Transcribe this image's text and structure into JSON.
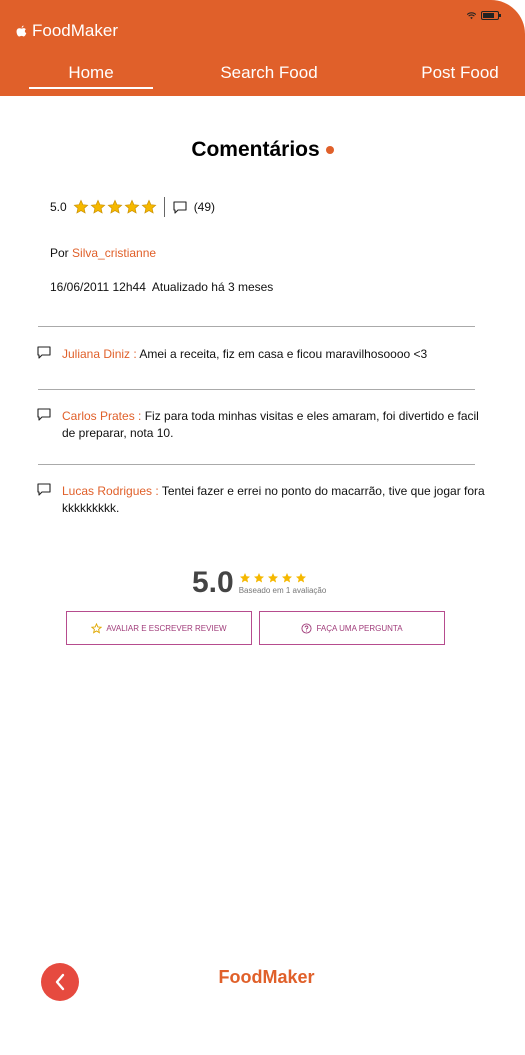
{
  "header": {
    "brand": "FoodMaker",
    "tabs": [
      {
        "label": "Home",
        "active": true
      },
      {
        "label": "Search Food",
        "active": false
      },
      {
        "label": "Post Food",
        "active": false
      }
    ]
  },
  "page": {
    "title": "Comentários",
    "rating_value": "5.0",
    "rating_stars": 5,
    "comment_count": "(49)",
    "author_prefix": "Por",
    "author": "Silva_cristianne",
    "date": "16/06/2011 12h44",
    "updated": "Atualizado há 3 meses"
  },
  "comments": [
    {
      "name": "Juliana Diniz :",
      "text": "Amei a receita, fiz em casa e ficou maravilhosoooo <3"
    },
    {
      "name": "Carlos Prates :",
      "text": "Fiz para toda minhas visitas e eles amaram, foi divertido e facil de preparar, nota 10."
    },
    {
      "name": "Lucas Rodrigues :",
      "text": "Tentei fazer e errei no ponto do macarrão, tive que jogar fora kkkkkkkkk."
    }
  ],
  "summary": {
    "score": "5.0",
    "stars": 5,
    "based_on": "Baseado em 1 avaliação",
    "review_button": "AVALIAR E ESCREVER REVIEW",
    "question_button": "FAÇA UMA PERGUNTA"
  },
  "footer": {
    "brand": "FoodMaker"
  },
  "colors": {
    "accent": "#e0602a",
    "star": "#f5b800",
    "button_border": "#b64c8e",
    "back_button": "#e64a3f"
  },
  "icons": [
    "apple-icon",
    "wifi-icon",
    "battery-icon",
    "star-icon",
    "comment-icon",
    "question-icon",
    "chevron-left-icon"
  ]
}
